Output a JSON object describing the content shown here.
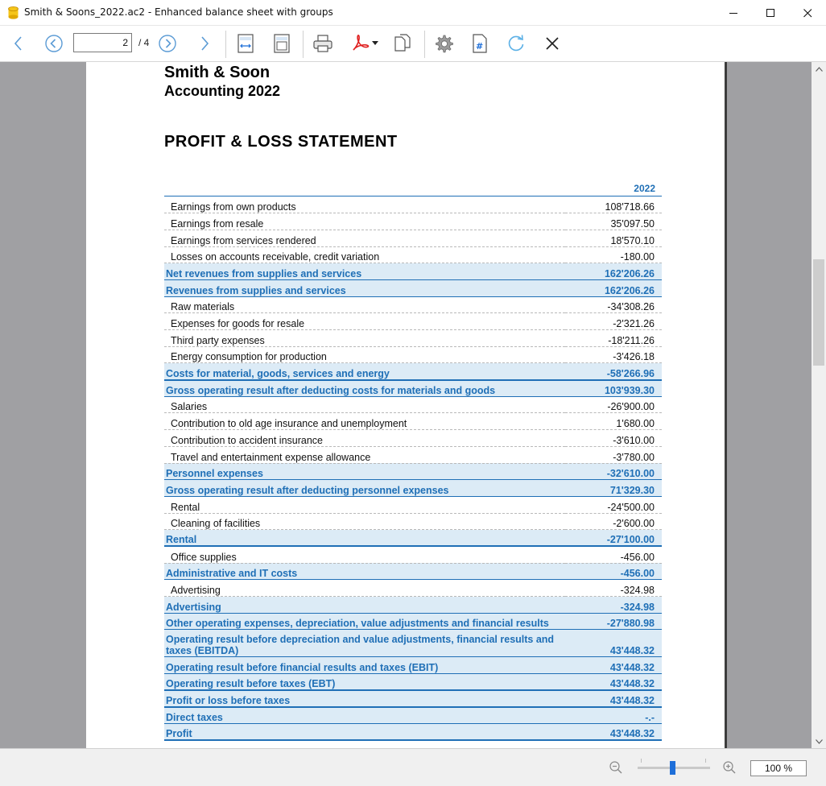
{
  "window": {
    "title": "Smith & Soons_2022.ac2 - Enhanced balance sheet with groups"
  },
  "toolbar": {
    "page_value": "2",
    "page_total": "/ 4"
  },
  "report": {
    "company": "Smith & Soon",
    "subtitle": "Accounting 2022",
    "title": "PROFIT & LOSS STATEMENT",
    "column_header": "2022",
    "rows": [
      {
        "label": "Earnings from own products",
        "amount": "108'718.66",
        "kind": "detail"
      },
      {
        "label": "Earnings from resale",
        "amount": "35'097.50",
        "kind": "detail"
      },
      {
        "label": "Earnings from services rendered",
        "amount": "18'570.10",
        "kind": "detail"
      },
      {
        "label": "Losses on accounts receivable, credit variation",
        "amount": "-180.00",
        "kind": "detail"
      },
      {
        "label": "Net revenues from supplies and services",
        "amount": "162'206.26",
        "kind": "subtotal"
      },
      {
        "label": "Revenues from supplies and services",
        "amount": "162'206.26",
        "kind": "subtotal"
      },
      {
        "label": "Raw materials",
        "amount": "-34'308.26",
        "kind": "detail"
      },
      {
        "label": "Expenses for goods for resale",
        "amount": "-2'321.26",
        "kind": "detail"
      },
      {
        "label": "Third party expenses",
        "amount": "-18'211.26",
        "kind": "detail"
      },
      {
        "label": "Energy consumption for production",
        "amount": "-3'426.18",
        "kind": "detail"
      },
      {
        "label": "Costs for material, goods, services and energy",
        "amount": "-58'266.96",
        "kind": "subtotal-thick"
      },
      {
        "label": "Gross operating result after deducting costs for materials and goods",
        "amount": "103'939.30",
        "kind": "subtotal"
      },
      {
        "label": "Salaries",
        "amount": "-26'900.00",
        "kind": "detail"
      },
      {
        "label": "Contribution to old age insurance and unemployment",
        "amount": "1'680.00",
        "kind": "detail"
      },
      {
        "label": "Contribution to accident insurance",
        "amount": "-3'610.00",
        "kind": "detail"
      },
      {
        "label": "Travel and entertainment expense allowance",
        "amount": "-3'780.00",
        "kind": "detail"
      },
      {
        "label": "Personnel expenses",
        "amount": "-32'610.00",
        "kind": "subtotal"
      },
      {
        "label": "Gross operating result after deducting personnel expenses",
        "amount": "71'329.30",
        "kind": "subtotal"
      },
      {
        "label": "Rental",
        "amount": "-24'500.00",
        "kind": "detail"
      },
      {
        "label": "Cleaning of facilities",
        "amount": "-2'600.00",
        "kind": "detail"
      },
      {
        "label": "Rental",
        "amount": "-27'100.00",
        "kind": "subtotal-thick"
      },
      {
        "label": "Office supplies",
        "amount": "-456.00",
        "kind": "detail"
      },
      {
        "label": "Administrative and IT costs",
        "amount": "-456.00",
        "kind": "subtotal"
      },
      {
        "label": "Advertising",
        "amount": "-324.98",
        "kind": "detail"
      },
      {
        "label": "Advertising",
        "amount": "-324.98",
        "kind": "subtotal"
      },
      {
        "label": "Other operating expenses, depreciation, value adjustments and financial results",
        "amount": "-27'880.98",
        "kind": "subtotal"
      },
      {
        "label": "Operating result before depreciation and value adjustments, financial results and taxes (EBITDA)",
        "amount": "43'448.32",
        "kind": "subtotal-wrap"
      },
      {
        "label": "Operating result before financial results and taxes (EBIT)",
        "amount": "43'448.32",
        "kind": "subtotal"
      },
      {
        "label": "Operating result before taxes (EBT)",
        "amount": "43'448.32",
        "kind": "subtotal-thick"
      },
      {
        "label": "Profit or loss before taxes",
        "amount": "43'448.32",
        "kind": "subtotal-thick"
      },
      {
        "label": "Direct taxes",
        "amount": "-.-",
        "kind": "subtotal"
      },
      {
        "label": "Profit",
        "amount": "43'448.32",
        "kind": "subtotal-thick"
      }
    ]
  },
  "statusbar": {
    "zoom_value": "100 %"
  },
  "colors": {
    "accent_blue": "#1f6fb6",
    "subtotal_fill": "#dcebf6",
    "viewport_gray": "#a0a0a3"
  }
}
